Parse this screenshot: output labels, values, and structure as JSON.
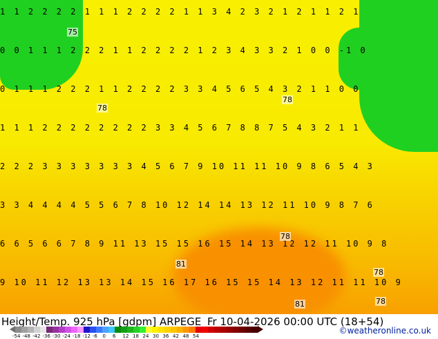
{
  "map": {
    "contour_labels": [
      "75",
      "78",
      "78",
      "78",
      "78",
      "81",
      "78",
      "81",
      "78"
    ],
    "number_rows": [
      "1 1 2 2 2 2 1 1 1 2 2 2 2 1 1 3 4 2 3 2 1 2 1 1 2 1",
      "0 0 1 1 1 2 2 2 1 1 2 2 2 2 1 2 3 4 3 3 2 1 0 0 -1 0",
      "0 1 1 1 2 2 2 1 1 2 2 2 2 3 3 4 5 6 5 4 3 2 1 1 0 0",
      "1 1 1 2 2 2 2 2 2 2 2 3 3 4 5 6 7 8 8 7 5 4 3 2 1 1",
      "2 2 2 3 3 3 3 3 3 3 4 5 6 7 9 10 11 11 10 9 8 6 5 4 3",
      "3 3 4 4 4 4 5 5 6 7 8 10 12 14 14 13 12 11 10 9 8 7 6",
      "6 6 5 6 6 7 8 9 11 13 15 15 16 15 14 13 12 12 11 10 9 8",
      "9 10 11 12 13 13 14 15 16 17 16 15 15 14 13 12 11 11 10 9"
    ]
  },
  "footer": {
    "title": "Height/Temp. 925 hPa [gdpm] ARPEGE",
    "datetime": "Fr 10-04-2026 00:00 UTC (18+54)",
    "credit": "©weatheronline.co.uk",
    "legend_colors": [
      "#8c8c8c",
      "#a0a0a0",
      "#b4b4b4",
      "#d2d2d2",
      "#e6e6e6",
      "#782878",
      "#9632a0",
      "#b43cc8",
      "#d250e6",
      "#f064ff",
      "#fa96ff",
      "#1e14c8",
      "#2850f0",
      "#3c78ff",
      "#50a0ff",
      "#3cc8fa",
      "#0a8c0a",
      "#14a014",
      "#1eb41e",
      "#28d228",
      "#32f032",
      "#fafa32",
      "#fff000",
      "#ffe100",
      "#ffd200",
      "#ffc300",
      "#ffaf00",
      "#ff9600",
      "#ff7800",
      "#e60000",
      "#f00000",
      "#d20000",
      "#be0000",
      "#aa0000",
      "#960000",
      "#820000",
      "#6e0000",
      "#5a0000",
      "#460000"
    ],
    "legend_ticks": [
      "-54",
      "-48",
      "-42",
      "-36",
      "-30",
      "-24",
      "-18",
      "-12",
      "-6",
      "0",
      "6",
      "12",
      "18",
      "24",
      "30",
      "36",
      "42",
      "48",
      "54"
    ]
  }
}
